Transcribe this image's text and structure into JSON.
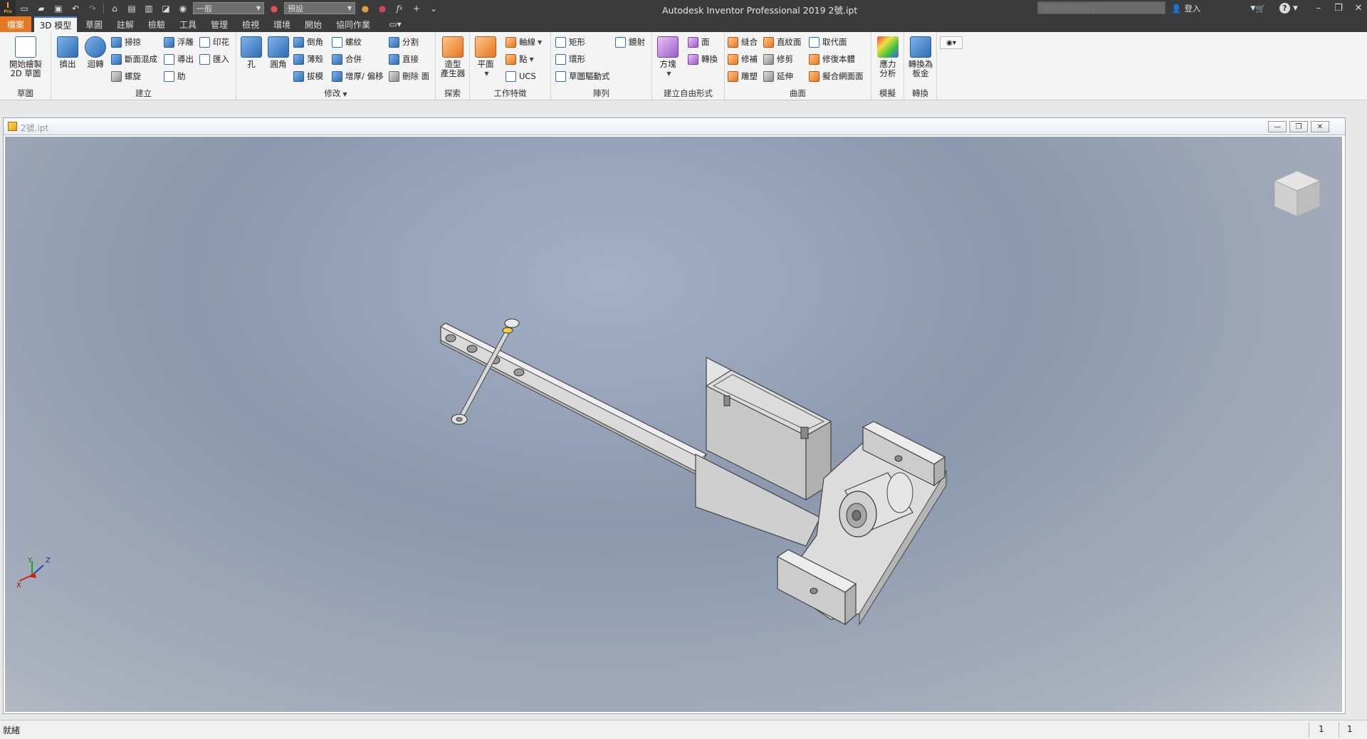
{
  "app": {
    "title": "Autodesk Inventor Professional 2019    2號.ipt",
    "logo_text": "I",
    "logo_sub": "Pro"
  },
  "qat": {
    "material": "一般",
    "appearance": "預設",
    "fx": "f",
    "fx_sub": "x"
  },
  "search": {
    "placeholder": "搜尋說明與指令..."
  },
  "user": {
    "signin": "登入"
  },
  "tabs": [
    {
      "label": "檔案"
    },
    {
      "label": "3D 模型"
    },
    {
      "label": "草圖"
    },
    {
      "label": "註解"
    },
    {
      "label": "檢驗"
    },
    {
      "label": "工具"
    },
    {
      "label": "管理"
    },
    {
      "label": "檢視"
    },
    {
      "label": "環境"
    },
    {
      "label": "開始"
    },
    {
      "label": "協同作業"
    }
  ],
  "ribbon": {
    "sketch": {
      "label": "草圖",
      "start": "開始繪製",
      "start2": "2D 草圖"
    },
    "create": {
      "label": "建立",
      "extrude": "擠出",
      "revolve": "迴轉",
      "sweep": "掃掠",
      "loft": "斷面混成",
      "coil": "螺旋",
      "emboss": "浮雕",
      "derive": "導出",
      "rib": "肋",
      "decal": "印花",
      "import": "匯入"
    },
    "modify": {
      "label": "修改",
      "hole": "孔",
      "fillet": "圓角",
      "chamfer": "倒角",
      "shell": "薄殼",
      "draft": "拔模",
      "thread": "螺紋",
      "combine": "合併",
      "thicken": "增厚/ 偏移",
      "split": "分割",
      "direct": "直接",
      "delete_face": "刪除 面"
    },
    "explore": {
      "label": "探索",
      "shape_gen1": "造型",
      "shape_gen2": "產生器"
    },
    "workfeatures": {
      "label": "工作特徵",
      "plane": "平面",
      "axis": "軸線",
      "point": "點",
      "ucs": "UCS"
    },
    "pattern": {
      "label": "陣列",
      "rect": "矩形",
      "circ": "環形",
      "sketch_driven": "草圖驅動式",
      "mirror": "鏡射"
    },
    "freeform": {
      "label": "建立自由形式",
      "box": "方塊",
      "face": "面",
      "convert": "轉換"
    },
    "surface": {
      "label": "曲面",
      "stitch": "縫合",
      "patch": "修補",
      "sculpt": "雕塑",
      "ruled": "直紋面",
      "trim": "修剪",
      "extend": "延伸",
      "replace": "取代面",
      "repair": "修復本體",
      "fit_mesh": "擬合網面面"
    },
    "simulation": {
      "label": "模擬",
      "stress1": "應力",
      "stress2": "分析"
    },
    "convert": {
      "label": "轉換",
      "sm1": "轉換為",
      "sm2": "板金"
    }
  },
  "document": {
    "name": "2號.ipt"
  },
  "triad": {
    "x": "X",
    "y": "Y",
    "z": "Z"
  },
  "status": {
    "text": "就緒",
    "count1": "1",
    "count2": "1"
  }
}
